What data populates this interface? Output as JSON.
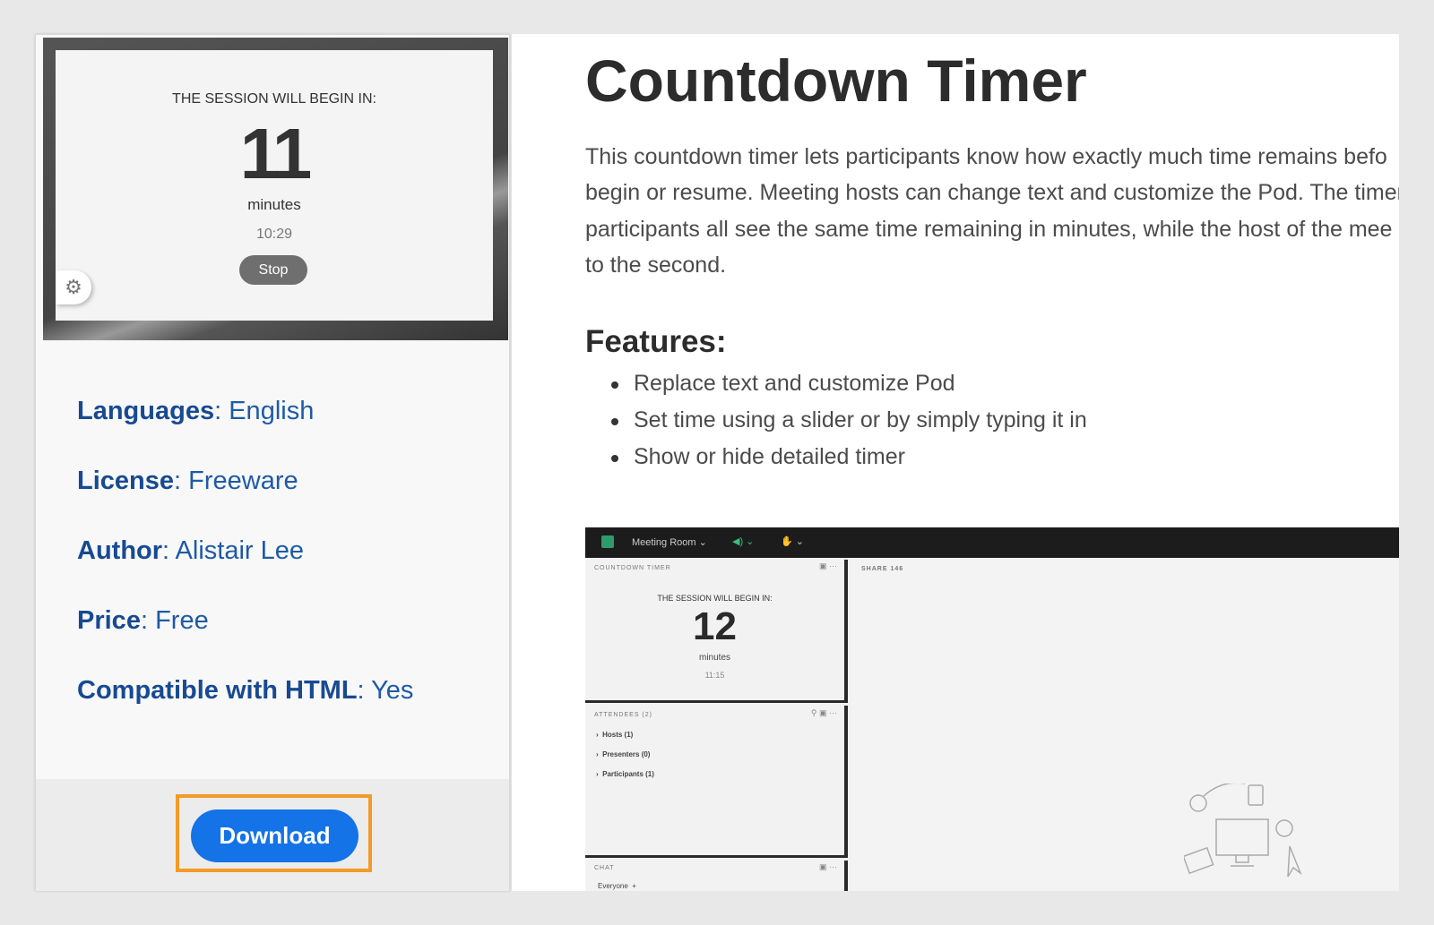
{
  "preview": {
    "heading": "THE SESSION WILL BEGIN IN:",
    "minutes_value": "11",
    "minutes_label": "minutes",
    "time": "10:29",
    "stop_label": "Stop",
    "settings_icon": "gear-icon"
  },
  "info": [
    {
      "label": "Languages",
      "value": "English"
    },
    {
      "label": "License",
      "value": "Freeware"
    },
    {
      "label": "Author",
      "value": "Alistair Lee"
    },
    {
      "label": "Price",
      "value": "Free"
    },
    {
      "label": "Compatible with HTML",
      "value": "Yes"
    }
  ],
  "download_label": "Download",
  "colors": {
    "accent": "#1473e6",
    "highlight": "#f29b26",
    "info_text": "#1e5aa6"
  },
  "main": {
    "title": "Countdown Timer",
    "paragraph_lines": [
      "This countdown timer lets participants know how exactly much time remains befo",
      "begin or resume. Meeting hosts can change text and customize the Pod. The timer",
      "participants all see the same time remaining in minutes, while the host of the mee",
      "to the second."
    ],
    "features_heading": "Features:",
    "features": [
      "Replace text and customize Pod",
      "Set time using a slider or by simply typing it in",
      "Show or hide detailed timer"
    ]
  },
  "screenshot": {
    "room_label": "Meeting Room",
    "countdown_pod_title": "COUNTDOWN TIMER",
    "heading": "THE SESSION WILL BEGIN IN:",
    "minutes_value": "12",
    "minutes_label": "minutes",
    "time": "11:15",
    "attendees_title": "ATTENDEES  (2)",
    "attendee_groups": [
      "Hosts (1)",
      "Presenters (0)",
      "Participants (1)"
    ],
    "chat_title": "CHAT",
    "chat_target": "Everyone",
    "share_title": "SHARE 146"
  }
}
